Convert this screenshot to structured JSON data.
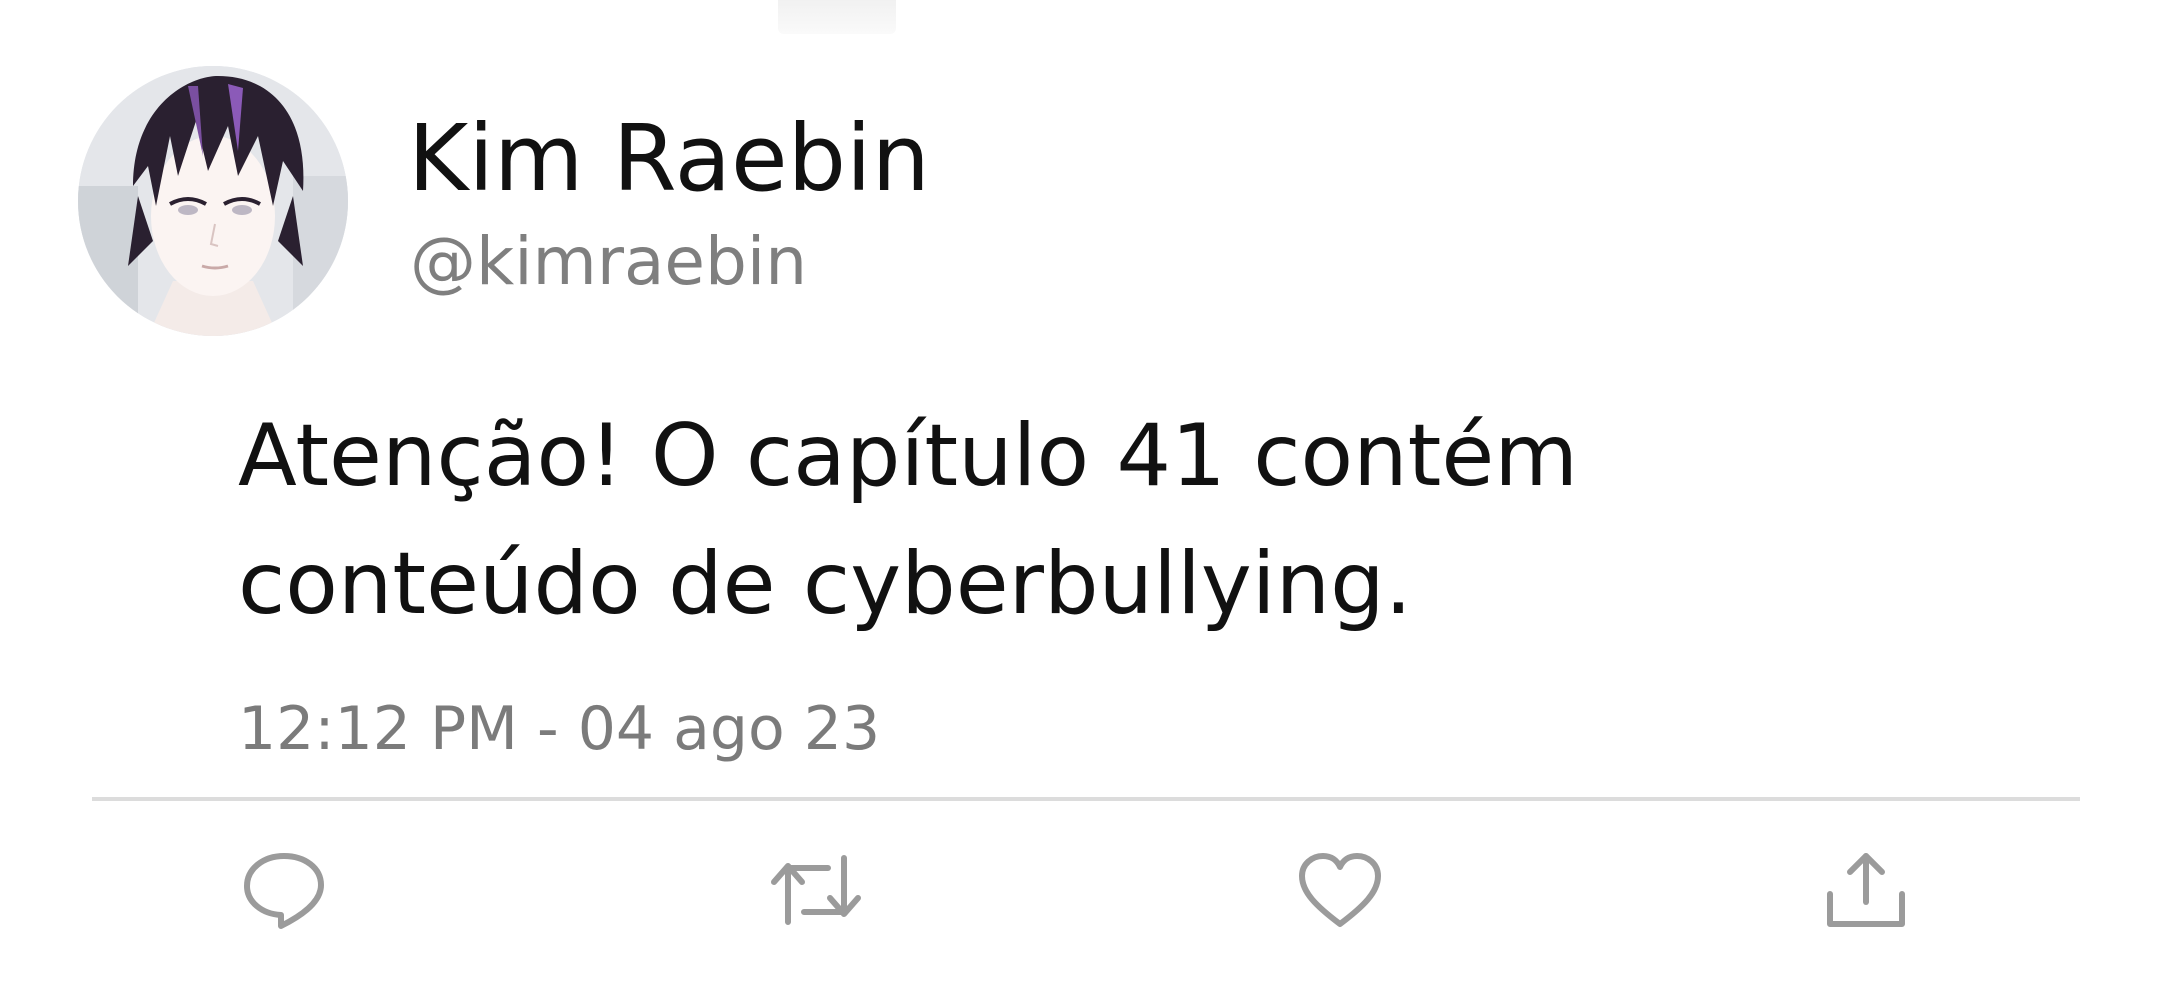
{
  "author": {
    "display_name": "Kim Raebin",
    "handle": "@kimraebin"
  },
  "tweet": {
    "text_lines": [
      "Atenção! O capítulo 41 contém",
      "conteúdo de cyberbullying."
    ],
    "timestamp": "12:12 PM - 04 ago 23"
  },
  "actions": [
    {
      "icon": "reply-icon"
    },
    {
      "icon": "retweet-icon"
    },
    {
      "icon": "like-icon"
    },
    {
      "icon": "share-icon"
    }
  ],
  "colors": {
    "text_primary": "#111111",
    "text_secondary": "#7f7f7f",
    "icon_gray": "#9b9b9b",
    "divider": "#dcdcdc"
  }
}
